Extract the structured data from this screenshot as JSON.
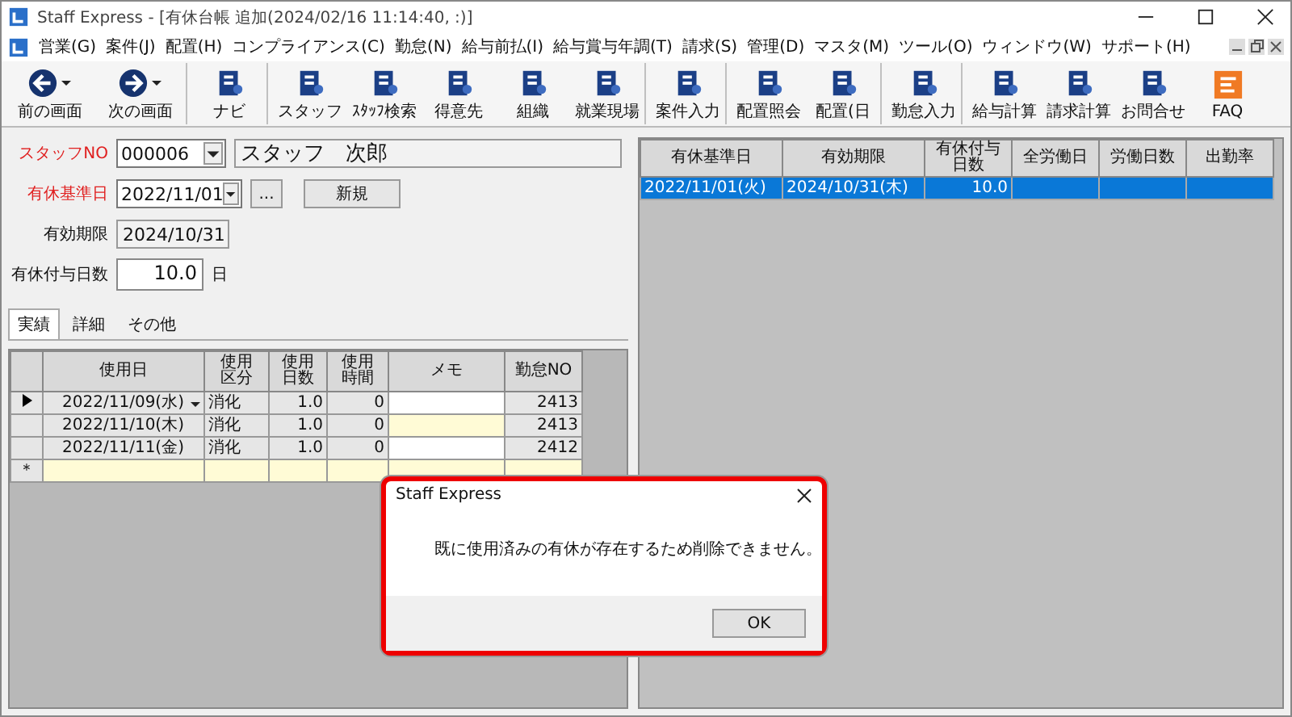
{
  "window": {
    "title": "Staff Express - [有休台帳 追加(2024/02/16 11:14:40, :)]"
  },
  "menu": [
    "営業(G)",
    "案件(J)",
    "配置(H)",
    "コンプライアンス(C)",
    "勤怠(N)",
    "給与前払(I)",
    "給与賞与年調(T)",
    "請求(S)",
    "管理(D)",
    "マスタ(M)",
    "ツール(O)",
    "ウィンドウ(W)",
    "サポート(H)"
  ],
  "toolbar": [
    {
      "label": "前の画面",
      "kind": "nav",
      "separator_after": false
    },
    {
      "label": "次の画面",
      "kind": "nav",
      "separator_after": true
    },
    {
      "label": "ナビ",
      "kind": "tool",
      "separator_after": true
    },
    {
      "label": "スタッフ",
      "kind": "tool",
      "separator_after": false
    },
    {
      "label": "ｽﾀｯﾌ検索",
      "kind": "tool",
      "separator_after": false
    },
    {
      "label": "得意先",
      "kind": "tool",
      "separator_after": false
    },
    {
      "label": "組織",
      "kind": "tool",
      "separator_after": false
    },
    {
      "label": "就業現場",
      "kind": "tool",
      "separator_after": true
    },
    {
      "label": "案件入力",
      "kind": "tool",
      "separator_after": true
    },
    {
      "label": "配置照会",
      "kind": "tool",
      "separator_after": false
    },
    {
      "label": "配置(日",
      "kind": "tool",
      "separator_after": true
    },
    {
      "label": "勤怠入力",
      "kind": "tool",
      "separator_after": true
    },
    {
      "label": "給与計算",
      "kind": "tool",
      "separator_after": false
    },
    {
      "label": "請求計算",
      "kind": "tool",
      "separator_after": false
    },
    {
      "label": "お問合せ",
      "kind": "tool",
      "separator_after": false
    },
    {
      "label": "FAQ",
      "kind": "faq",
      "separator_after": false
    }
  ],
  "form": {
    "staff_no": {
      "label": "スタッフNO",
      "required": true,
      "value": "000006",
      "name": "スタッフ　次郎"
    },
    "base_date": {
      "label": "有休基準日",
      "required": true,
      "value": "2022/11/01",
      "browse": "...",
      "new_button": "新規"
    },
    "expiry": {
      "label": "有効期限",
      "required": false,
      "value": "2024/10/31"
    },
    "granted_days": {
      "label": "有休付与日数",
      "required": false,
      "value": "10.0",
      "unit": "日"
    }
  },
  "tabs": [
    {
      "label": "実績",
      "selected": true
    },
    {
      "label": "詳細",
      "selected": false
    },
    {
      "label": "その他",
      "selected": false
    }
  ],
  "usage_table": {
    "columns": [
      "使用日",
      "使用区分",
      "使用日数",
      "使用時間",
      "メモ",
      "勤怠NO"
    ],
    "rows": [
      {
        "kind": "current",
        "cells": [
          "2022/11/09(水)",
          "消化",
          "1.0",
          "0",
          "",
          "2413"
        ]
      },
      {
        "kind": "row",
        "cells": [
          "2022/11/10(木)",
          "消化",
          "1.0",
          "0",
          "",
          "2413"
        ]
      },
      {
        "kind": "row",
        "cells": [
          "2022/11/11(金)",
          "消化",
          "1.0",
          "0",
          "",
          "2412"
        ]
      },
      {
        "kind": "new",
        "marker": "＊",
        "cells": [
          "",
          "",
          "",
          "",
          "",
          ""
        ]
      }
    ]
  },
  "grant_table": {
    "columns": [
      "有休基準日",
      "有効期限",
      "有休付与日数",
      "全労働日",
      "労働日数",
      "出勤率"
    ],
    "rows": [
      {
        "selected": true,
        "cells": [
          "2022/11/01(火)",
          "2024/10/31(木)",
          "10.0",
          "",
          "",
          ""
        ]
      }
    ]
  },
  "dialog": {
    "title": "Staff Express",
    "message": "既に使用済みの有休が存在するため削除できません。",
    "button": "OK"
  }
}
